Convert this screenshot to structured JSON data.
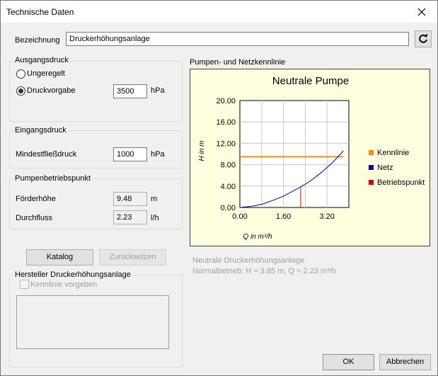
{
  "window": {
    "title": "Technische Daten"
  },
  "bezeichnung": {
    "label": "Bezeichnung",
    "value": "Druckerhöhungsanlage"
  },
  "ausgangsdruck": {
    "title": "Ausgangsdruck",
    "option_ungeregelt": "Ungeregelt",
    "option_druckvorgabe": "Druckvorgabe",
    "selected": "Druckvorgabe",
    "value": "3500",
    "unit": "hPa"
  },
  "eingangsdruck": {
    "title": "Eingangsdruck",
    "label": "Mindestfließdruck",
    "value": "1000",
    "unit": "hPa"
  },
  "betriebspunkt": {
    "title": "Pumpenbetriebspunkt",
    "foerderhoehe_label": "Förderhöhe",
    "foerderhoehe_value": "9.48",
    "foerderhoehe_unit": "m",
    "durchfluss_label": "Durchfluss",
    "durchfluss_value": "2.23",
    "durchfluss_unit": "l/h"
  },
  "buttons": {
    "katalog": "Katalog",
    "zuruecksetzen": "Zurücksetzen",
    "ok": "OK",
    "abbrechen": "Abbrechen"
  },
  "hersteller": {
    "title": "Hersteller Druckerhöhungsanlage",
    "kennlinie_checkbox": "Kennlinie vorgeben",
    "kennlinie_checked": false
  },
  "chart_section": {
    "title": "Pumpen- und Netzkennlinie",
    "info_line1": "Neutrale Druckerhöhungsanlage",
    "info_line2": "Normalbetrieb: H = 3.85 m, Q = 2.23 m³/h"
  },
  "chart_data": {
    "type": "line",
    "title": "Neutrale Pumpe",
    "xlabel": "Q in m³/h",
    "ylabel": "H in m",
    "xlim": [
      0,
      4.0
    ],
    "ylim": [
      0,
      20
    ],
    "x_ticks": [
      "0.00",
      "1.60",
      "3.20"
    ],
    "y_ticks": [
      "0.00",
      "4.00",
      "8.00",
      "12.00",
      "16.00",
      "20.00"
    ],
    "grid": true,
    "legend_position": "right",
    "series": [
      {
        "name": "Kennlinie",
        "color": "#ff8c00",
        "x": [
          0,
          3.8
        ],
        "y": [
          9.48,
          9.48
        ]
      },
      {
        "name": "Netz",
        "color": "#0000cc",
        "x": [
          0,
          0.4,
          0.8,
          1.2,
          1.6,
          2.0,
          2.23,
          2.6,
          3.0,
          3.4,
          3.8
        ],
        "y": [
          0.0,
          0.2,
          0.6,
          1.3,
          2.1,
          3.2,
          3.85,
          5.0,
          6.6,
          8.4,
          10.6
        ]
      },
      {
        "name": "Betriebspunkt",
        "color": "#e00000",
        "x": [
          2.23,
          2.23
        ],
        "y": [
          0,
          3.85
        ]
      }
    ]
  },
  "colors": {
    "chart_background": "#ffffe0",
    "kennlinie": "#ff8c00",
    "netz": "#0000cc",
    "betriebspunkt": "#e00000"
  },
  "icons": {
    "close": "close-icon",
    "refresh": "refresh-icon"
  }
}
